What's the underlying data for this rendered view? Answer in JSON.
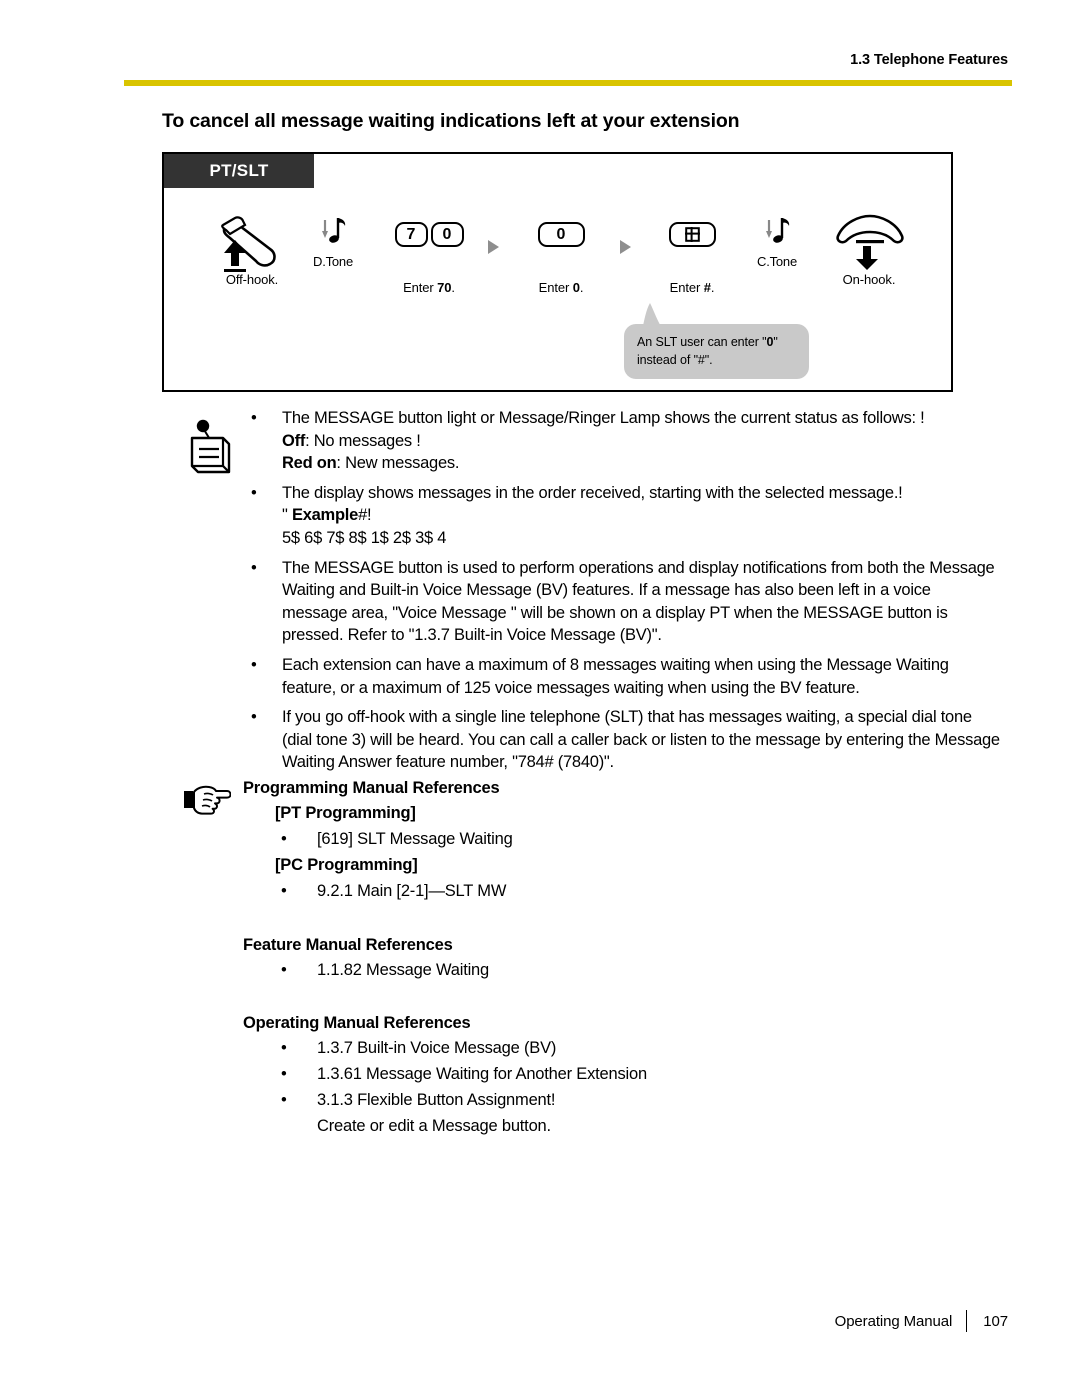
{
  "header": {
    "chapter": "1.3 Telephone Features",
    "rule_color": "#d9c400"
  },
  "title": "To cancel all message waiting indications left at your extension",
  "diagram": {
    "tag": "PT/SLT",
    "tag_bg": "#333333",
    "steps": [
      {
        "id": "off-hook",
        "glyph": "handset-offhook",
        "caption_pre": "Off-hook.",
        "caption_bold": "",
        "caption_post": ""
      },
      {
        "id": "dial-tone",
        "glyph": "tone",
        "tone_label": "D.Tone"
      },
      {
        "id": "enter-70",
        "glyph": "keys",
        "keys": [
          "7",
          "0"
        ],
        "caption_pre": "Enter ",
        "caption_bold": "70",
        "caption_post": "."
      },
      {
        "id": "enter-0",
        "glyph": "keys",
        "keys": [
          "0"
        ],
        "caption_pre": "Enter ",
        "caption_bold": "0",
        "caption_post": "."
      },
      {
        "id": "enter-hash",
        "glyph": "keys",
        "keys": [
          "#"
        ],
        "caption_pre": "Enter ",
        "caption_bold": "#",
        "caption_post": "."
      },
      {
        "id": "confirm-tone",
        "glyph": "tone",
        "tone_label": "C.Tone"
      },
      {
        "id": "on-hook",
        "glyph": "handset-onhook",
        "caption_pre": "On-hook.",
        "caption_bold": "",
        "caption_post": ""
      }
    ],
    "callout": {
      "pre": "An SLT user can enter \"",
      "bold": "0",
      "post": "\" instead of \"#\".",
      "bg": "#c9c9c9"
    }
  },
  "notes": [
    {
      "lines": [
        {
          "pre": "The MESSAGE button light or Message/Ringer Lamp shows the current status as follows: !",
          "bold": "",
          "post": ""
        },
        {
          "pre": "",
          "bold": "Off",
          "post": ": No messages !"
        },
        {
          "pre": "",
          "bold": "Red on",
          "post": ": New messages."
        }
      ]
    },
    {
      "lines": [
        {
          "pre": "The display shows messages in the order received, starting with the selected message.!",
          "bold": "",
          "post": ""
        },
        {
          "pre": "\" ",
          "bold": "Example",
          "post": "#!"
        },
        {
          "pre": "5$ 6$ 7$ 8$ 1$ 2$ 3$ 4",
          "bold": "",
          "post": ""
        }
      ]
    },
    {
      "lines": [
        {
          "pre": "The MESSAGE button is used to perform operations and display notifications from both the Message Waiting and Built-in Voice Message (BV) features. If a message has also been left in a voice message area, \"Voice Message    \" will be shown on a display PT when the MESSAGE button is pressed. Refer to \"1.3.7 Built-in Voice Message (BV)\".",
          "bold": "",
          "post": ""
        }
      ]
    },
    {
      "lines": [
        {
          "pre": "Each extension can have a maximum of 8 messages waiting when using the Message Waiting feature, or a maximum of 125 voice messages waiting when using the BV feature.",
          "bold": "",
          "post": ""
        }
      ]
    },
    {
      "lines": [
        {
          "pre": "If you go off-hook with a single line telephone (SLT) that has messages waiting, a special dial tone (dial tone 3) will be heard. You can call a caller back or listen to the message by entering the Message Waiting Answer feature number, \"784# (7840)\".",
          "bold": "",
          "post": ""
        }
      ]
    }
  ],
  "references": {
    "programming": {
      "title": "Programming Manual References",
      "groups": [
        {
          "heading": "[PT Programming]",
          "items": [
            {
              "text": "[619] SLT Message Waiting",
              "cont": ""
            }
          ]
        },
        {
          "heading": "[PC Programming]",
          "items": [
            {
              "text": "9.2.1 Main [2-1]—SLT MW",
              "cont": ""
            }
          ]
        }
      ]
    },
    "feature": {
      "title": "Feature Manual References",
      "items": [
        {
          "text": "1.1.82 Message Waiting",
          "cont": ""
        }
      ]
    },
    "operating": {
      "title": "Operating Manual References",
      "items": [
        {
          "text": "1.3.7 Built-in Voice Message (BV)",
          "cont": ""
        },
        {
          "text": "1.3.61 Message Waiting for Another Extension",
          "cont": ""
        },
        {
          "text": "3.1.3 Flexible Button Assignment!",
          "cont": "Create or edit a Message button."
        }
      ]
    }
  },
  "footer": {
    "label": "Operating Manual",
    "page": "107"
  }
}
